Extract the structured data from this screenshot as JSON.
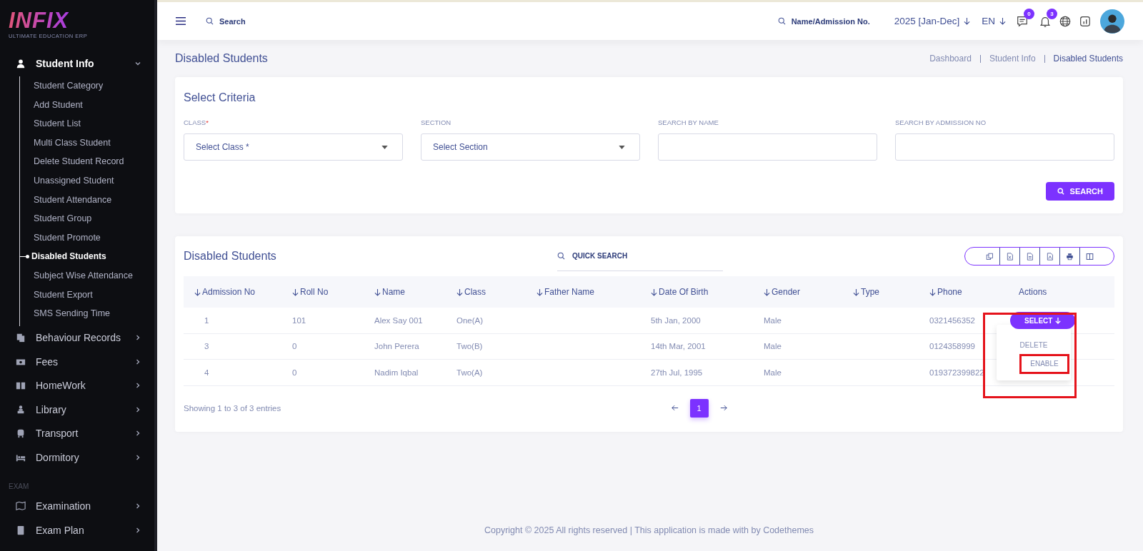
{
  "logo": {
    "name": "INFIX",
    "tagline": "ULTIMATE EDUCATION ERP"
  },
  "sidebar": {
    "groups": [
      {
        "items": [
          {
            "label": "Student Info",
            "expanded": true,
            "children": [
              {
                "label": "Student Category",
                "selected": false
              },
              {
                "label": "Add Student",
                "selected": false
              },
              {
                "label": "Student List",
                "selected": false
              },
              {
                "label": "Multi Class Student",
                "selected": false
              },
              {
                "label": "Delete Student Record",
                "selected": false
              },
              {
                "label": "Unassigned Student",
                "selected": false
              },
              {
                "label": "Student Attendance",
                "selected": false
              },
              {
                "label": "Student Group",
                "selected": false
              },
              {
                "label": "Student Promote",
                "selected": false
              },
              {
                "label": "Disabled Students",
                "selected": true
              },
              {
                "label": "Subject Wise Attendance",
                "selected": false
              },
              {
                "label": "Student Export",
                "selected": false
              },
              {
                "label": "SMS Sending Time",
                "selected": false
              }
            ]
          },
          {
            "label": "Behaviour Records",
            "expanded": false
          },
          {
            "label": "Fees",
            "expanded": false
          },
          {
            "label": "HomeWork",
            "expanded": false
          },
          {
            "label": "Library",
            "expanded": false
          },
          {
            "label": "Transport",
            "expanded": false
          },
          {
            "label": "Dormitory",
            "expanded": false
          }
        ]
      },
      {
        "label": "EXAM",
        "items": [
          {
            "label": "Examination",
            "expanded": false
          },
          {
            "label": "Exam Plan",
            "expanded": false
          }
        ]
      }
    ]
  },
  "header": {
    "search_placeholder": "Search",
    "admission_search_placeholder": "Name/Admission No.",
    "session": "2025 [Jan-Dec]",
    "language": "EN",
    "messages_badge": "0",
    "notifications_badge": "3"
  },
  "page_title": "Disabled Students",
  "breadcrumbs": [
    {
      "label": "Dashboard",
      "selected": false
    },
    {
      "label": "Student Info",
      "selected": false
    },
    {
      "label": "Disabled Students",
      "selected": true
    }
  ],
  "criteria": {
    "title": "Select Criteria",
    "fields": [
      {
        "label": "CLASS",
        "required_mark": "*",
        "kind": "select",
        "placeholder": "Select Class *"
      },
      {
        "label": "SECTION",
        "kind": "select",
        "placeholder": "Select Section"
      },
      {
        "label": "SEARCH BY NAME",
        "kind": "text"
      },
      {
        "label": "SEARCH BY ADMISSION NO",
        "kind": "text"
      }
    ],
    "search_button": "SEARCH"
  },
  "table": {
    "title": "Disabled Students",
    "quick_search_placeholder": "QUICK SEARCH",
    "columns": [
      {
        "label": "Admission No",
        "sortable": true
      },
      {
        "label": "Roll No",
        "sortable": true
      },
      {
        "label": "Name",
        "sortable": true
      },
      {
        "label": "Class",
        "sortable": true
      },
      {
        "label": "Father Name",
        "sortable": true
      },
      {
        "label": "Date Of Birth",
        "sortable": true
      },
      {
        "label": "Gender",
        "sortable": true
      },
      {
        "label": "Type",
        "sortable": true
      },
      {
        "label": "Phone",
        "sortable": true
      },
      {
        "label": "Actions",
        "sortable": false
      }
    ],
    "rows": [
      {
        "cells": [
          "1",
          "101",
          "Alex Say 001",
          "One(A)",
          "",
          "5th Jan, 2000",
          "Male",
          "",
          "0321456352"
        ],
        "menu_open": true
      },
      {
        "cells": [
          "3",
          "0",
          "John Perera",
          "Two(B)",
          "",
          "14th Mar, 2001",
          "Male",
          "",
          "0124358999"
        ],
        "menu_open": false
      },
      {
        "cells": [
          "4",
          "0",
          "Nadim Iqbal",
          "Two(A)",
          "",
          "27th Jul, 1995",
          "Male",
          "",
          "019372399822"
        ],
        "menu_open": false
      }
    ],
    "action_button": "SELECT",
    "menu": {
      "highlighted": true,
      "items": [
        {
          "label": "DELETE",
          "highlighted": false
        },
        {
          "label": "ENABLE",
          "highlighted": true
        }
      ]
    },
    "summary": "Showing 1 to 3 of 3 entries",
    "pages": [
      {
        "label": "1",
        "selected": true
      }
    ]
  },
  "copyright": "Copyright © 2025 All rights reserved | This application is made with by Codethemes"
}
